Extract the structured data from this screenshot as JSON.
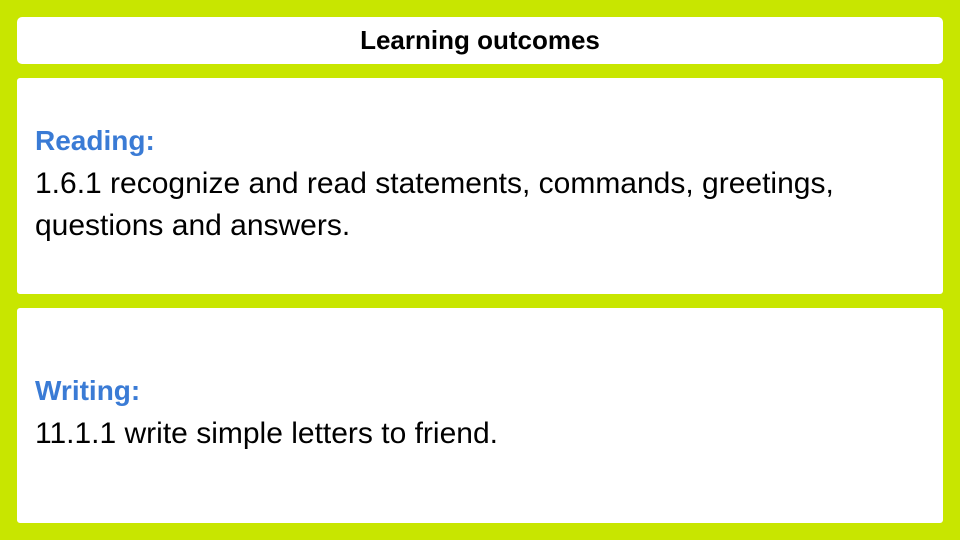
{
  "header": {
    "title": "Learning outcomes"
  },
  "sections": [
    {
      "id": "reading",
      "label": "Reading:",
      "text": "1.6.1    recognize    and    read    statements, commands, greetings, questions and answers."
    },
    {
      "id": "writing",
      "label": "Writing:",
      "text": "11.1.1  write simple letters to friend."
    }
  ],
  "colors": {
    "background": "#c8e600",
    "box_bg": "#ffffff",
    "label_color": "#3a7bd5",
    "text_color": "#000000"
  }
}
